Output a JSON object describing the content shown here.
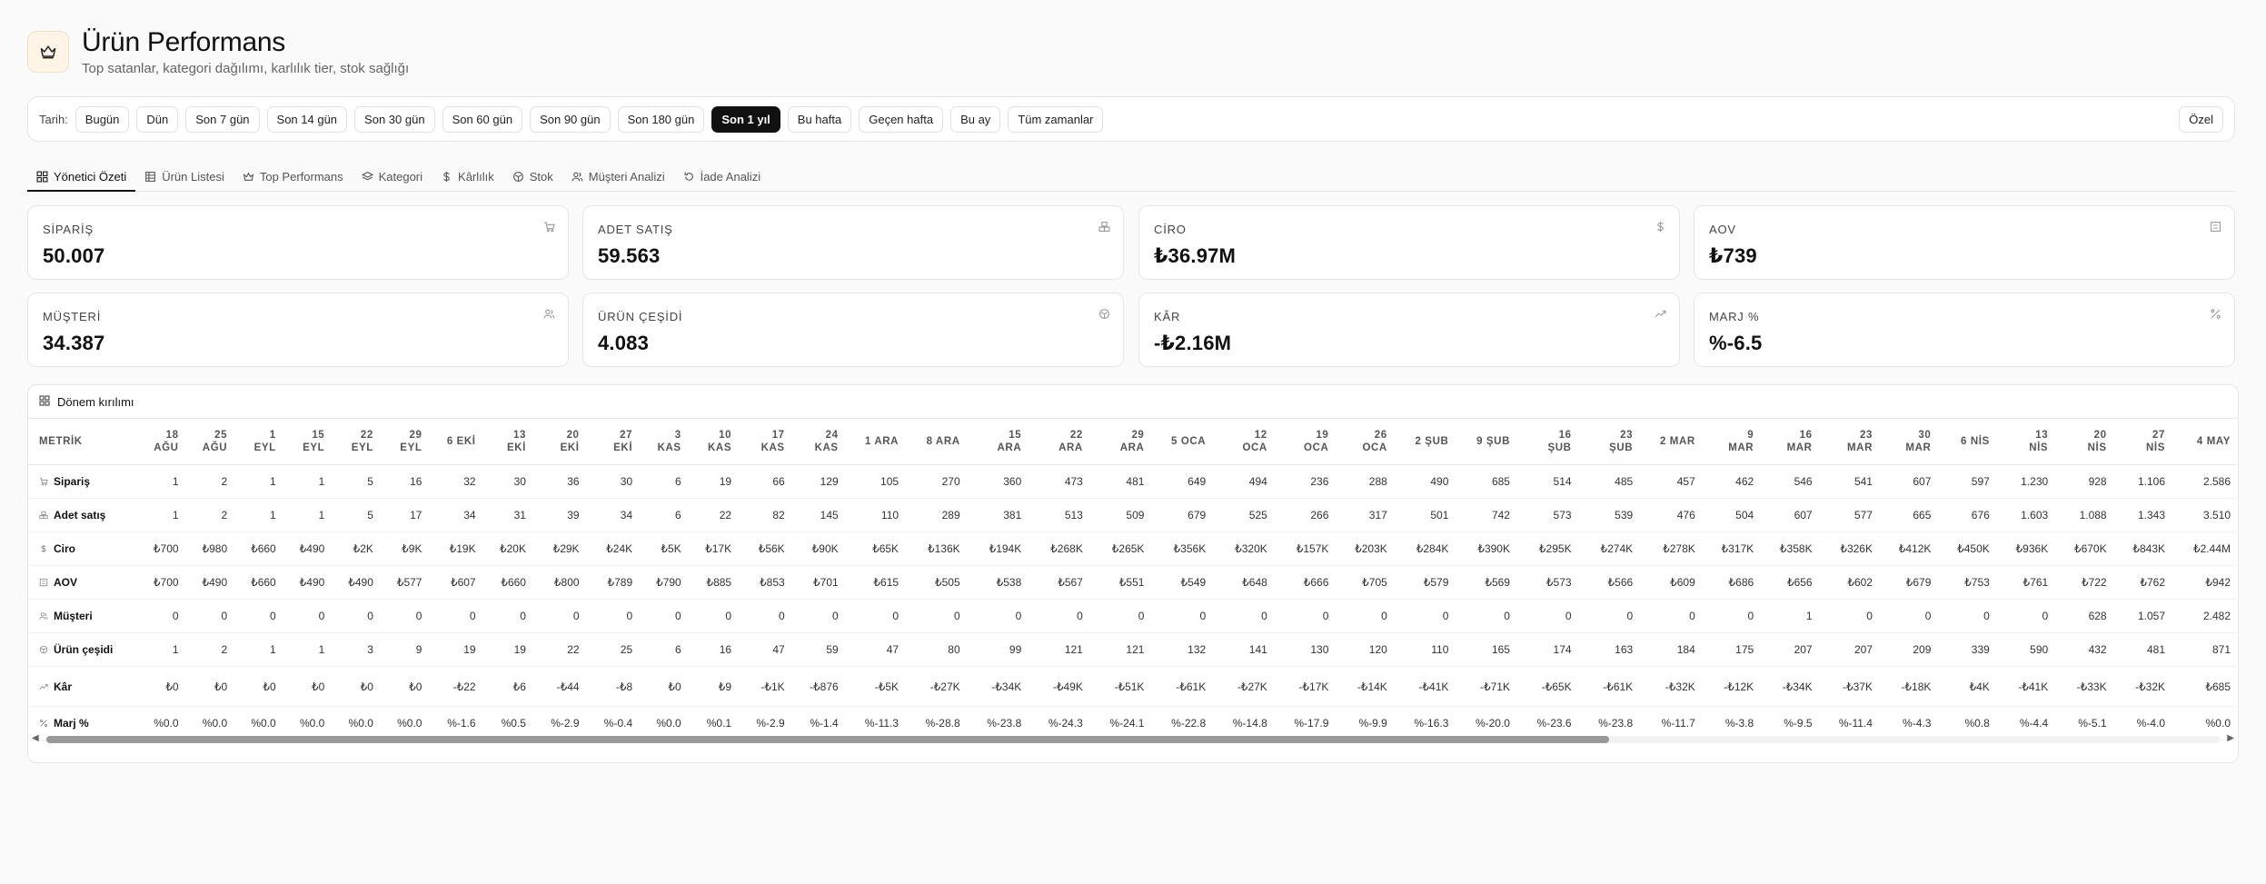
{
  "header": {
    "title": "Ürün Performans",
    "subtitle": "Top satanlar, kategori dağılımı, karlılık tier, stok sağlığı"
  },
  "filter": {
    "label": "Tarih:",
    "options": [
      "Bugün",
      "Dün",
      "Son 7 gün",
      "Son 14 gün",
      "Son 30 gün",
      "Son 60 gün",
      "Son 90 gün",
      "Son 180 gün",
      "Son 1 yıl",
      "Bu hafta",
      "Geçen hafta",
      "Bu ay",
      "Tüm zamanlar"
    ],
    "active": "Son 1 yıl",
    "custom": "Özel"
  },
  "tabs": [
    "Yönetici Özeti",
    "Ürün Listesi",
    "Top Performans",
    "Kategori",
    "Kârlılık",
    "Stok",
    "Müşteri Analizi",
    "İade Analizi"
  ],
  "active_tab": "Yönetici Özeti",
  "kpis": [
    {
      "label": "SİPARİŞ",
      "value": "50.007",
      "icon": "cart-icon"
    },
    {
      "label": "ADET SATIŞ",
      "value": "59.563",
      "icon": "boxes-icon"
    },
    {
      "label": "CİRO",
      "value": "₺36.97M",
      "icon": "dollar-icon"
    },
    {
      "label": "AOV",
      "value": "₺739",
      "icon": "receipt-icon"
    },
    {
      "label": "MÜŞTERİ",
      "value": "34.387",
      "icon": "users-icon"
    },
    {
      "label": "ÜRÜN ÇEŞİDİ",
      "value": "4.083",
      "icon": "package-icon"
    },
    {
      "label": "KÂR",
      "value": "-₺2.16M",
      "icon": "trend-up-icon"
    },
    {
      "label": "MARJ %",
      "value": "%-6.5",
      "icon": "percent-icon"
    }
  ],
  "breakdown": {
    "title": "Dönem kırılımı",
    "metric_header": "METRİK",
    "columns": [
      "18\nAĞU",
      "25\nAĞU",
      "1\nEYL",
      "15\nEYL",
      "22\nEYL",
      "29\nEYL",
      "6 EKİ",
      "13\nEKİ",
      "20\nEKİ",
      "27\nEKİ",
      "3\nKAS",
      "10\nKAS",
      "17\nKAS",
      "24\nKAS",
      "1 ARA",
      "8 ARA",
      "15\nARA",
      "22\nARA",
      "29\nARA",
      "5 OCA",
      "12\nOCA",
      "19\nOCA",
      "26\nOCA",
      "2 ŞUB",
      "9 ŞUB",
      "16\nŞUB",
      "23\nŞUB",
      "2 MAR",
      "9\nMAR",
      "16\nMAR",
      "23\nMAR",
      "30\nMAR",
      "6 NİS",
      "13\nNİS",
      "20\nNİS",
      "27\nNİS",
      "4 MAY"
    ],
    "rows": [
      {
        "metric": "Sipariş",
        "icon": "cart-icon",
        "values": [
          "1",
          "2",
          "1",
          "1",
          "5",
          "16",
          "32",
          "30",
          "36",
          "30",
          "6",
          "19",
          "66",
          "129",
          "105",
          "270",
          "360",
          "473",
          "481",
          "649",
          "494",
          "236",
          "288",
          "490",
          "685",
          "514",
          "485",
          "457",
          "462",
          "546",
          "541",
          "607",
          "597",
          "1.230",
          "928",
          "1.106",
          "2.586"
        ]
      },
      {
        "metric": "Adet satış",
        "icon": "boxes-icon",
        "values": [
          "1",
          "2",
          "1",
          "1",
          "5",
          "17",
          "34",
          "31",
          "39",
          "34",
          "6",
          "22",
          "82",
          "145",
          "110",
          "289",
          "381",
          "513",
          "509",
          "679",
          "525",
          "266",
          "317",
          "501",
          "742",
          "573",
          "539",
          "476",
          "504",
          "607",
          "577",
          "665",
          "676",
          "1.603",
          "1.088",
          "1.343",
          "3.510"
        ]
      },
      {
        "metric": "Ciro",
        "icon": "dollar-icon",
        "values": [
          "₺700",
          "₺980",
          "₺660",
          "₺490",
          "₺2K",
          "₺9K",
          "₺19K",
          "₺20K",
          "₺29K",
          "₺24K",
          "₺5K",
          "₺17K",
          "₺56K",
          "₺90K",
          "₺65K",
          "₺136K",
          "₺194K",
          "₺268K",
          "₺265K",
          "₺356K",
          "₺320K",
          "₺157K",
          "₺203K",
          "₺284K",
          "₺390K",
          "₺295K",
          "₺274K",
          "₺278K",
          "₺317K",
          "₺358K",
          "₺326K",
          "₺412K",
          "₺450K",
          "₺936K",
          "₺670K",
          "₺843K",
          "₺2.44M"
        ]
      },
      {
        "metric": "AOV",
        "icon": "receipt-icon",
        "values": [
          "₺700",
          "₺490",
          "₺660",
          "₺490",
          "₺490",
          "₺577",
          "₺607",
          "₺660",
          "₺800",
          "₺789",
          "₺790",
          "₺885",
          "₺853",
          "₺701",
          "₺615",
          "₺505",
          "₺538",
          "₺567",
          "₺551",
          "₺549",
          "₺648",
          "₺666",
          "₺705",
          "₺579",
          "₺569",
          "₺573",
          "₺566",
          "₺609",
          "₺686",
          "₺656",
          "₺602",
          "₺679",
          "₺753",
          "₺761",
          "₺722",
          "₺762",
          "₺942"
        ]
      },
      {
        "metric": "Müşteri",
        "icon": "users-icon",
        "values": [
          "0",
          "0",
          "0",
          "0",
          "0",
          "0",
          "0",
          "0",
          "0",
          "0",
          "0",
          "0",
          "0",
          "0",
          "0",
          "0",
          "0",
          "0",
          "0",
          "0",
          "0",
          "0",
          "0",
          "0",
          "0",
          "0",
          "0",
          "0",
          "0",
          "1",
          "0",
          "0",
          "0",
          "0",
          "628",
          "1.057",
          "2.482"
        ]
      },
      {
        "metric": "Ürün çeşidi",
        "icon": "package-icon",
        "values": [
          "1",
          "2",
          "1",
          "1",
          "3",
          "9",
          "19",
          "19",
          "22",
          "25",
          "6",
          "16",
          "47",
          "59",
          "47",
          "80",
          "99",
          "121",
          "121",
          "132",
          "141",
          "130",
          "120",
          "110",
          "165",
          "174",
          "163",
          "184",
          "175",
          "207",
          "207",
          "209",
          "339",
          "590",
          "432",
          "481",
          "871"
        ]
      },
      {
        "metric": "Kâr",
        "icon": "trend-up-icon",
        "values": [
          "₺0",
          "₺0",
          "₺0",
          "₺0",
          "₺0",
          "₺0",
          "-₺22",
          "₺6",
          "-₺44",
          "-₺8",
          "₺0",
          "₺9",
          "-₺1K",
          "-₺876",
          "-₺5K",
          "-₺27K",
          "-₺34K",
          "-₺49K",
          "-₺51K",
          "-₺61K",
          "-₺27K",
          "-₺17K",
          "-₺14K",
          "-₺41K",
          "-₺71K",
          "-₺65K",
          "-₺61K",
          "-₺32K",
          "-₺12K",
          "-₺34K",
          "-₺37K",
          "-₺18K",
          "₺4K",
          "-₺41K",
          "-₺33K",
          "-₺32K",
          "₺685"
        ]
      },
      {
        "metric": "Marj %",
        "icon": "percent-icon",
        "values": [
          "%0.0",
          "%0.0",
          "%0.0",
          "%0.0",
          "%0.0",
          "%0.0",
          "%-1.6",
          "%0.5",
          "%-2.9",
          "%-0.4",
          "%0.0",
          "%0.1",
          "%-2.9",
          "%-1.4",
          "%-11.3",
          "%-28.8",
          "%-23.8",
          "%-24.3",
          "%-24.1",
          "%-22.8",
          "%-14.8",
          "%-17.9",
          "%-9.9",
          "%-16.3",
          "%-20.0",
          "%-23.6",
          "%-23.8",
          "%-11.7",
          "%-3.8",
          "%-9.5",
          "%-11.4",
          "%-4.3",
          "%0.8",
          "%-4.4",
          "%-5.1",
          "%-4.0",
          "%0.0"
        ]
      }
    ]
  }
}
